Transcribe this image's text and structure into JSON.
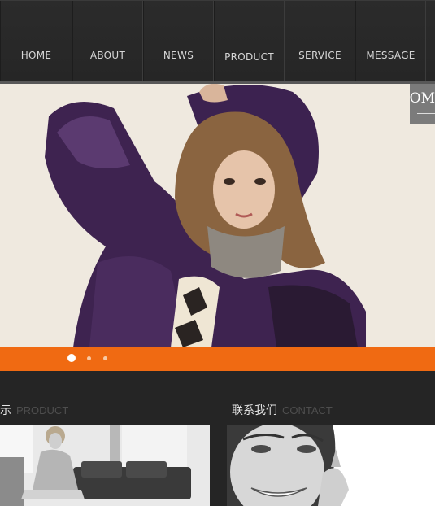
{
  "nav": {
    "items": [
      {
        "label": "HOME"
      },
      {
        "label": "ABOUT"
      },
      {
        "label": "NEWS"
      },
      {
        "label": "PRODUCT"
      },
      {
        "label": "SERVICE"
      },
      {
        "label": "MESSAGE"
      }
    ]
  },
  "banner": {
    "side_tab_text": "OM",
    "slides_total": 3,
    "active_slide": 1
  },
  "sections": {
    "product": {
      "title_cn": "示",
      "title_en": "PRODUCT"
    },
    "contact": {
      "title_cn": "联系我们",
      "title_en": "CONTACT"
    }
  },
  "colors": {
    "accent_orange": "#f06a12",
    "nav_bg": "#2a2a2a",
    "page_bg": "#252525"
  }
}
